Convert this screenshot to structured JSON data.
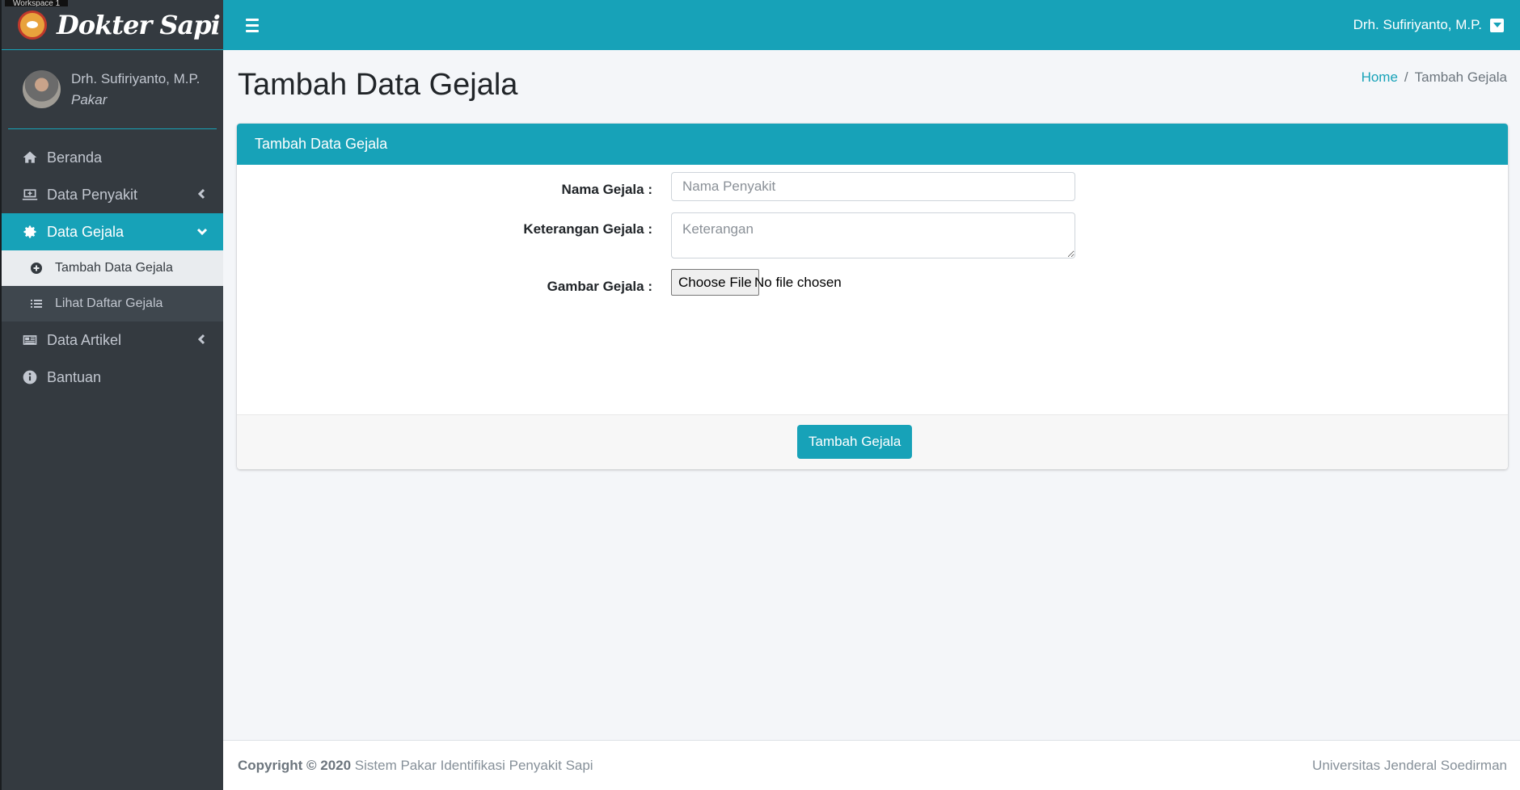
{
  "workspace": {
    "label": "Workspace 1"
  },
  "brand": {
    "name": "Dokter Sapi"
  },
  "user": {
    "name": "Drh. Sufiriyanto, M.P.",
    "role": "Pakar"
  },
  "sidebar": {
    "items": [
      {
        "label": "Beranda"
      },
      {
        "label": "Data Penyakit"
      },
      {
        "label": "Data Gejala"
      },
      {
        "label": "Data Artikel"
      },
      {
        "label": "Bantuan"
      }
    ],
    "subitems": [
      {
        "label": "Tambah Data Gejala"
      },
      {
        "label": "Lihat Daftar Gejala"
      }
    ]
  },
  "topbar": {
    "user": "Drh. Sufiriyanto, M.P."
  },
  "page": {
    "title": "Tambah Data Gejala",
    "breadcrumb": {
      "home": "Home",
      "separator": "/",
      "current": "Tambah Gejala"
    }
  },
  "card": {
    "title": "Tambah Data Gejala",
    "fields": {
      "nama_label": "Nama Gejala :",
      "nama_placeholder": "Nama Penyakit",
      "keterangan_label": "Keterangan Gejala :",
      "keterangan_placeholder": "Keterangan",
      "gambar_label": "Gambar Gejala :",
      "file_button": "Choose File",
      "file_status": "No file chosen"
    },
    "submit": "Tambah Gejala"
  },
  "footer": {
    "copyright_bold": "Copyright © 2020",
    "copyright_text": " Sistem Pakar Identifikasi Penyakit Sapi",
    "right": "Universitas Jenderal Soedirman"
  },
  "colors": {
    "accent": "#17a2b8",
    "sidebar": "#343a40"
  }
}
